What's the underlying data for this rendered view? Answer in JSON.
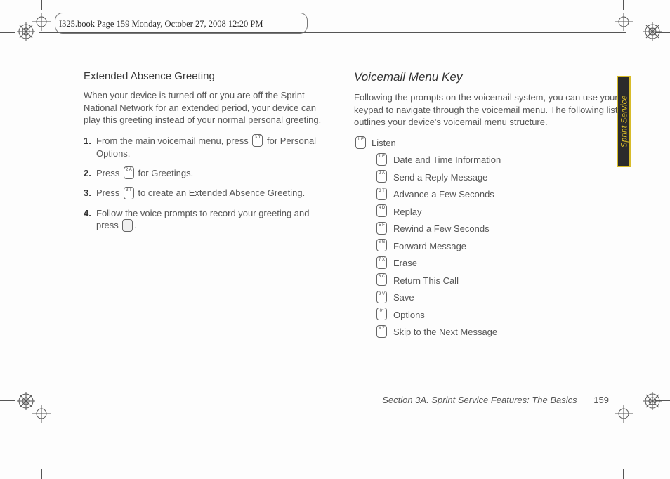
{
  "header_note": "I325.book  Page 159  Monday, October 27, 2008  12:20 PM",
  "side_tab": "Sprint Service",
  "left": {
    "heading": "Extended Absence Greeting",
    "intro": "When your device is turned off or you are off the Sprint National Network for an extended period, your device can play this greeting instead of your normal personal greeting.",
    "steps": [
      {
        "pre": "From the main voicemail menu, press ",
        "key": "3\nT",
        "post": " for Personal Options."
      },
      {
        "pre": "Press ",
        "key": "2\nA",
        "post": " for Greetings."
      },
      {
        "pre": "Press ",
        "key": "3\nT",
        "post": " to create an Extended Absence Greeting."
      },
      {
        "pre": "Follow the voice prompts to record your greeting and press ",
        "key": "",
        "post": "."
      }
    ]
  },
  "right": {
    "heading": "Voicemail Menu Key",
    "intro": "Following the prompts on the voicemail system, you can use your keypad to navigate through the voicemail menu. The following list outlines your device's voicemail menu structure.",
    "root": {
      "key": "1\nE",
      "label": "Listen"
    },
    "items": [
      {
        "key": "1\nE",
        "label": "Date and Time Information"
      },
      {
        "key": "2\nA",
        "label": "Send a Reply Message"
      },
      {
        "key": "3\nT",
        "label": "Advance a Few Seconds"
      },
      {
        "key": "4\nD",
        "label": "Replay"
      },
      {
        "key": "5\nF",
        "label": "Rewind a Few Seconds"
      },
      {
        "key": "6\nG",
        "label": "Forward Message"
      },
      {
        "key": "7\nX",
        "label": "Erase"
      },
      {
        "key": "8\nC",
        "label": "Return This Call"
      },
      {
        "key": "9\nV",
        "label": "Save"
      },
      {
        "key": "0*",
        "label": "Options"
      },
      {
        "key": "#\nZ",
        "label": "Skip to the Next Message"
      }
    ]
  },
  "footer": {
    "section": "Section 3A. Sprint Service Features: The Basics",
    "page": "159"
  }
}
